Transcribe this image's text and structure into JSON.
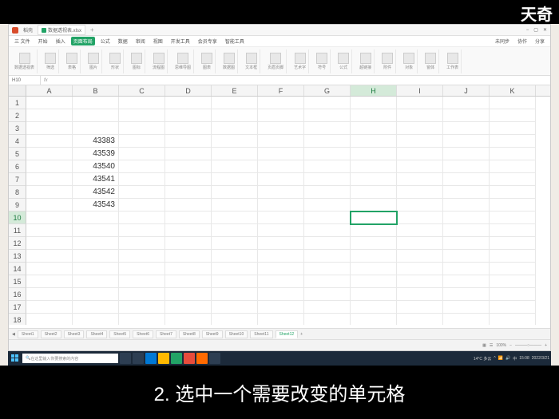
{
  "watermark": "天奇",
  "titlebar": {
    "filename": "数据透视表.xlsx"
  },
  "menubar": {
    "items": [
      "三 文件",
      "开始",
      "插入",
      "页面布局",
      "公式",
      "数据",
      "审阅",
      "视图",
      "开发工具",
      "会员专享",
      "智能工具"
    ],
    "active_index": 3,
    "right": [
      "未同步",
      "协作",
      "分享"
    ]
  },
  "ribbon": {
    "groups": [
      "数据透视表",
      "筛选",
      "表格",
      "图片",
      "形状",
      "图标",
      "流程图",
      "思维导图",
      "图表",
      "数据图",
      "文本框",
      "页眉页脚",
      "艺术字",
      "符号",
      "公式",
      "超链接",
      "附件",
      "对象",
      "窗体",
      "工作表"
    ]
  },
  "namebox": "H10",
  "columns": [
    "A",
    "B",
    "C",
    "D",
    "E",
    "F",
    "G",
    "H",
    "I",
    "J",
    "K"
  ],
  "selected_col_index": 7,
  "rows_count": 18,
  "selected_row": 10,
  "cells": {
    "B4": "43383",
    "B5": "43539",
    "B6": "43540",
    "B7": "43541",
    "B8": "43542",
    "B9": "43543"
  },
  "selected_cell": "H10",
  "sheettabs": {
    "tabs": [
      "Sheet1",
      "Sheet2",
      "Sheet3",
      "Sheet4",
      "Sheet5",
      "Sheet6",
      "Sheet7",
      "Sheet8",
      "Sheet9",
      "Sheet10",
      "Sheet11",
      "Sheet12"
    ],
    "active_index": 11
  },
  "statusbar": {
    "zoom": "100%"
  },
  "taskbar": {
    "search_placeholder": "在这里输入你要搜索的内容",
    "weather": "14°C 多云",
    "time": "15:08",
    "date": "2022/3/21"
  },
  "caption": "2. 选中一个需要改变的单元格"
}
